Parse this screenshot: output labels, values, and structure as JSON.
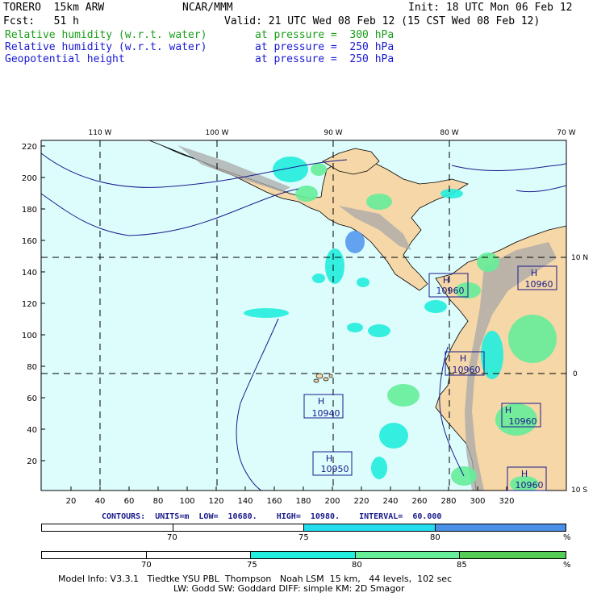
{
  "header": {
    "model": "TORERO  15km ARW",
    "org": "NCAR/MMM",
    "init": "Init: 18 UTC Mon 06 Feb 12",
    "fcst": "Fcst:   51 h",
    "valid": "Valid: 21 UTC Wed 08 Feb 12 (15 CST Wed 08 Feb 12)",
    "fields": [
      {
        "name": "Relative humidity (w.r.t. water)",
        "level": "at pressure =  300 hPa",
        "color": "#1a9e1a"
      },
      {
        "name": "Relative humidity (w.r.t. water)",
        "level": "at pressure =  250 hPa",
        "color": "#1a1ad2"
      },
      {
        "name": "Geopotential height",
        "level": "at pressure =  250 hPa",
        "color": "#1a1ad2"
      }
    ]
  },
  "map": {
    "top_lon_labels": [
      "110 W",
      "100 W",
      "90 W",
      "80 W",
      "70 W"
    ],
    "right_lat_labels": [
      "10 N",
      "0",
      "10 S"
    ],
    "y_ticks": [
      "220",
      "200",
      "180",
      "160",
      "140",
      "120",
      "100",
      "80",
      "60",
      "40",
      "20"
    ],
    "x_ticks": [
      "20",
      "40",
      "60",
      "80",
      "100",
      "120",
      "140",
      "160",
      "180",
      "200",
      "220",
      "240",
      "260",
      "280",
      "300",
      "320"
    ],
    "highs": [
      {
        "symbol": "H",
        "value": "10960"
      },
      {
        "symbol": "H",
        "value": "10960"
      },
      {
        "symbol": "H",
        "value": "10960"
      },
      {
        "symbol": "H",
        "value": "10940"
      },
      {
        "symbol": "H",
        "value": "10960"
      },
      {
        "symbol": "H",
        "value": "10950"
      },
      {
        "symbol": "H",
        "value": "10960"
      }
    ],
    "colors": {
      "ocean": "#ddfdfd",
      "land": "#f5d7a8",
      "terrain": "#a0a0a0",
      "rh_low": "#00e6e6",
      "rh_high": "#66cc66",
      "rh250": "#5599ee",
      "contour": "#1a1a8c"
    }
  },
  "contours_info": {
    "text": "CONTOURS:  UNITS=m  LOW=  10680.    HIGH=  10980.    INTERVAL=  60.000"
  },
  "scale1": {
    "labels": [
      "70",
      "75",
      "80",
      "%"
    ],
    "colors": [
      "#ffffff",
      "#ffffff",
      "#22ddee",
      "#4a90e8"
    ]
  },
  "scale2": {
    "labels": [
      "70",
      "75",
      "80",
      "85",
      "%"
    ],
    "colors": [
      "#ffffff",
      "#ffffff",
      "#22eedd",
      "#66ee99",
      "#55cc55"
    ]
  },
  "footer": {
    "line1": "Model Info: V3.3.1   Tiedtke YSU PBL  Thompson   Noah LSM  15 km,   44 levels,  102 sec",
    "line2": "LW: Godd SW: Goddard DIFF: simple KM: 2D Smagor"
  }
}
